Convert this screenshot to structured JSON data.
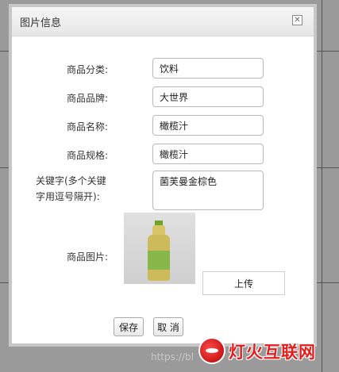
{
  "dialog": {
    "title": "图片信息",
    "close_icon": "close-icon"
  },
  "form": {
    "category": {
      "label": "商品分类:",
      "value": "饮料"
    },
    "brand": {
      "label": "商品品牌:",
      "value": "大世界"
    },
    "name": {
      "label": "商品名称:",
      "value": "橄榄汁"
    },
    "spec": {
      "label": "商品规格:",
      "value": "橄榄汁"
    },
    "keywords": {
      "label_line1": "关键字(多个关键",
      "label_line2": "字用逗号隔开):",
      "value": "菌芙曼金棕色"
    },
    "image": {
      "label": "商品图片:"
    }
  },
  "buttons": {
    "upload": "上传",
    "save": "保存",
    "cancel": "取 消"
  },
  "watermark": {
    "url": "https://bl",
    "brand": "灯火互联网"
  }
}
